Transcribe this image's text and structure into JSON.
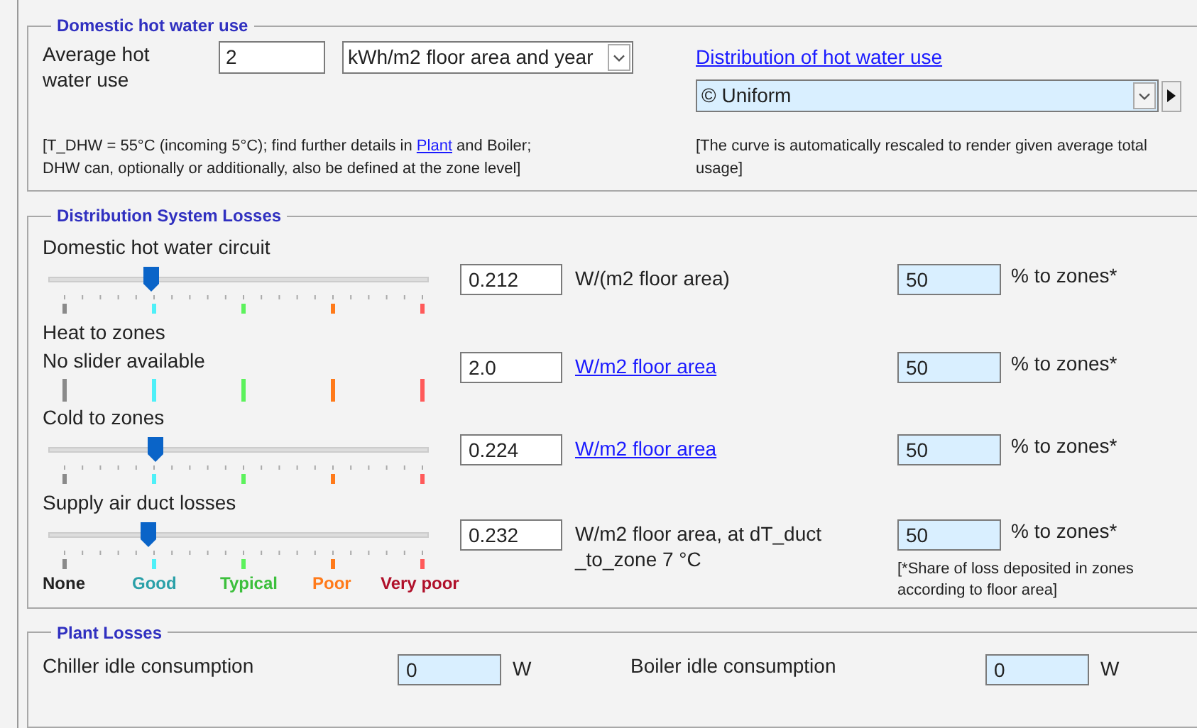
{
  "dhw": {
    "title": "Domestic hot water use",
    "label": "Average hot water use",
    "value": "2",
    "unit": "kWh/m2 floor area and year",
    "distribution_link": "Distribution of hot water use",
    "distribution": "© Uniform",
    "note_left": {
      "before": "[T_DHW = 55°C (incoming 5°C); find further details in ",
      "link": "Plant",
      "after": " and Boiler; DHW can, optionally or additionally, also be defined at the zone level]"
    },
    "note_right": "[The curve is automatically rescaled to render given average total usage]"
  },
  "distribution_losses": {
    "title": "Distribution System Losses",
    "rows": [
      {
        "label": "Domestic hot water circuit",
        "kind": "slider",
        "level": 0.27,
        "value": "0.212",
        "unit": {
          "kind": "text",
          "text": "W/(m2 floor area)"
        },
        "share": "50",
        "share_unit": "% to zones*"
      },
      {
        "label": "Heat to zones",
        "kind": "no_slider",
        "note": "No slider available",
        "value": "2.0",
        "unit": {
          "kind": "link",
          "text": "W/m2 floor area"
        },
        "share": "50",
        "share_unit": "% to zones*"
      },
      {
        "label": "Cold to zones",
        "kind": "slider",
        "level": 0.28,
        "value": "0.224",
        "unit": {
          "kind": "link",
          "text": "W/m2 floor area"
        },
        "share": "50",
        "share_unit": "% to zones*"
      },
      {
        "label": "Supply air duct losses",
        "kind": "slider",
        "level": 0.26,
        "value": "0.232",
        "unit": {
          "kind": "text",
          "text": "W/m2 floor area, at dT_duct _to_zone 7 °C"
        },
        "share": "50",
        "share_unit": "% to zones*"
      }
    ],
    "legend": [
      {
        "label": "None",
        "color": "#222222"
      },
      {
        "label": "Good",
        "color": "#2aa0a8"
      },
      {
        "label": "Typical",
        "color": "#3cbf3c"
      },
      {
        "label": "Poor",
        "color": "#ff7a1a"
      },
      {
        "label": "Very poor",
        "color": "#b0102a"
      }
    ],
    "footnote": "[*Share of loss deposited in zones according to floor area]"
  },
  "plant_losses": {
    "title": "Plant Losses",
    "items": [
      {
        "label": "Chiller idle consumption",
        "value": "0",
        "unit": "W"
      },
      {
        "label": "Boiler idle consumption",
        "value": "0",
        "unit": "W"
      }
    ]
  }
}
